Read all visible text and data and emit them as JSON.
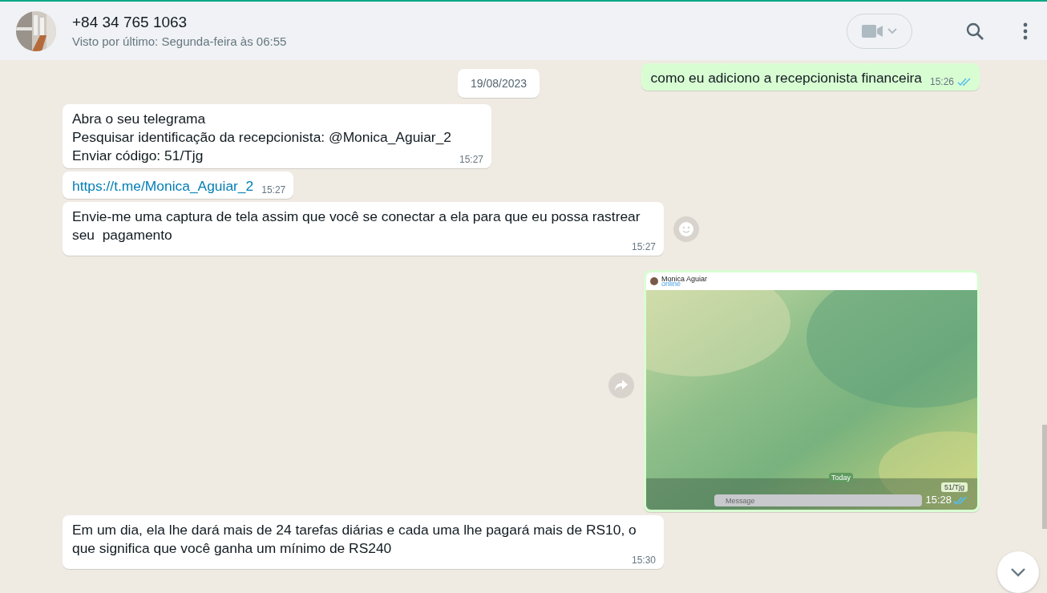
{
  "header": {
    "contact": "+84 34 765 1063",
    "status": "Visto por último: Segunda-feira às 06:55"
  },
  "date_chip": "19/08/2023",
  "messages": [
    {
      "kind": "text",
      "outgoing": true,
      "text": "como eu adiciono a recepcionista financeira",
      "time": "15:26",
      "read": true
    },
    {
      "kind": "text",
      "outgoing": false,
      "text": "Abra o seu telegrama\nPesquisar identificação da recepcionista: @Monica_Aguiar_2\nEnviar código: 51/Tjg",
      "time": "15:27"
    },
    {
      "kind": "link",
      "outgoing": false,
      "text": "https://t.me/Monica_Aguiar_2",
      "time": "15:27"
    },
    {
      "kind": "text",
      "outgoing": false,
      "text": "Envie-me uma captura de tela assim que você se conectar a ela para que eu possa rastrear seu  pagamento",
      "time": "15:27",
      "react_button": true
    },
    {
      "outgoing": true,
      "time": "15:28",
      "read": true,
      "forward_button": true,
      "screenshot": {
        "name": "Monica Aguiar",
        "status": "online",
        "day": "Today",
        "bubble": "51/Tjg",
        "input_placeholder": "Message"
      }
    },
    {
      "kind": "text",
      "outgoing": false,
      "text": "Em um dia, ela lhe dará mais de 24 tarefas diárias e cada uma lhe pagará mais de RS10, o que significa que você ganha um mínimo de RS240",
      "time": "15:30"
    }
  ]
}
